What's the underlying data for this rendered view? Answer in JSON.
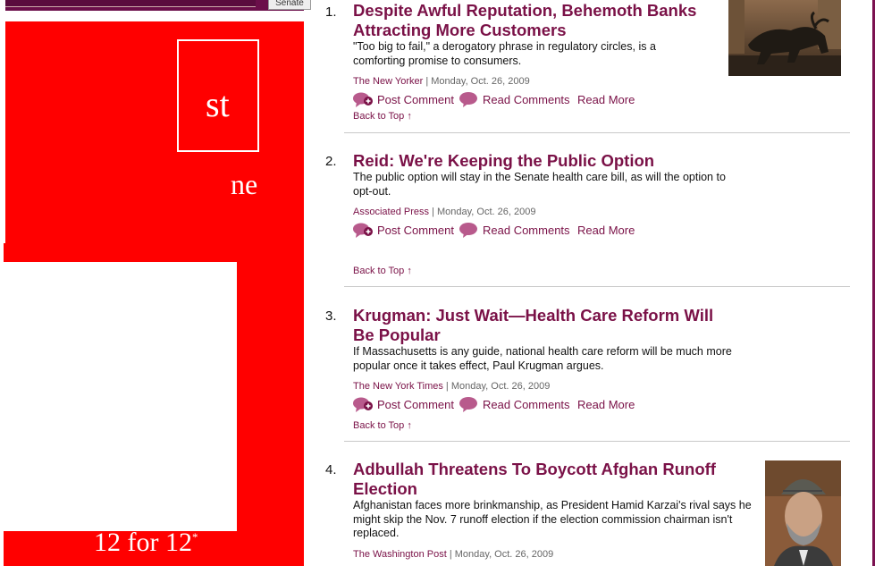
{
  "left_promo": {
    "search_button": "Senate",
    "partial_text_1": "st",
    "partial_text_2": "ne",
    "promo_label": "12 for 12",
    "promo_mark": "*"
  },
  "articles": [
    {
      "num": "1.",
      "title": "Despite Awful Reputation, Behemoth Banks Attracting More Customers",
      "blurb": "\"Too big to fail,\" a derogatory phrase in regulatory circles, is a comforting promise to consumers.",
      "source": "The New Yorker",
      "date": "Monday, Oct. 26, 2009",
      "post_comment": "Post Comment",
      "read_comments": "Read Comments",
      "read_more": "Read More",
      "back_to_top": "Back to Top",
      "image": "wall-street-bull-photo"
    },
    {
      "num": "2.",
      "title": "Reid: We're Keeping the Public Option",
      "blurb": "The public option will stay in the Senate health care bill, as will the option to opt-out.",
      "source": "Associated Press",
      "date": "Monday, Oct. 26, 2009",
      "post_comment": "Post Comment",
      "read_comments": "Read Comments",
      "read_more": "Read More",
      "back_to_top": "Back to Top"
    },
    {
      "num": "3.",
      "title": "Krugman: Just Wait—Health Care Reform Will Be Popular",
      "blurb": "If Massachusetts is any guide, national health care reform will be much more popular once it takes effect, Paul Krugman argues.",
      "source": "The New York Times",
      "date": "Monday, Oct. 26, 2009",
      "post_comment": "Post Comment",
      "read_comments": "Read Comments",
      "read_more": "Read More",
      "back_to_top": "Back to Top"
    },
    {
      "num": "4.",
      "title": "Adbullah Threatens To Boycott Afghan Runoff Election",
      "blurb": "Afghanistan faces more brinkmanship, as President Hamid Karzai's rival says he might skip the Nov. 7 runoff election if the election commission chairman isn't replaced.",
      "source": "The Washington Post",
      "date": "Monday, Oct. 26, 2009",
      "image": "hamid-karzai-portrait-photo"
    }
  ],
  "colors": {
    "accent": "#7a1147",
    "promo_red": "#ff0000",
    "frame_purple": "#6b0f4a"
  }
}
